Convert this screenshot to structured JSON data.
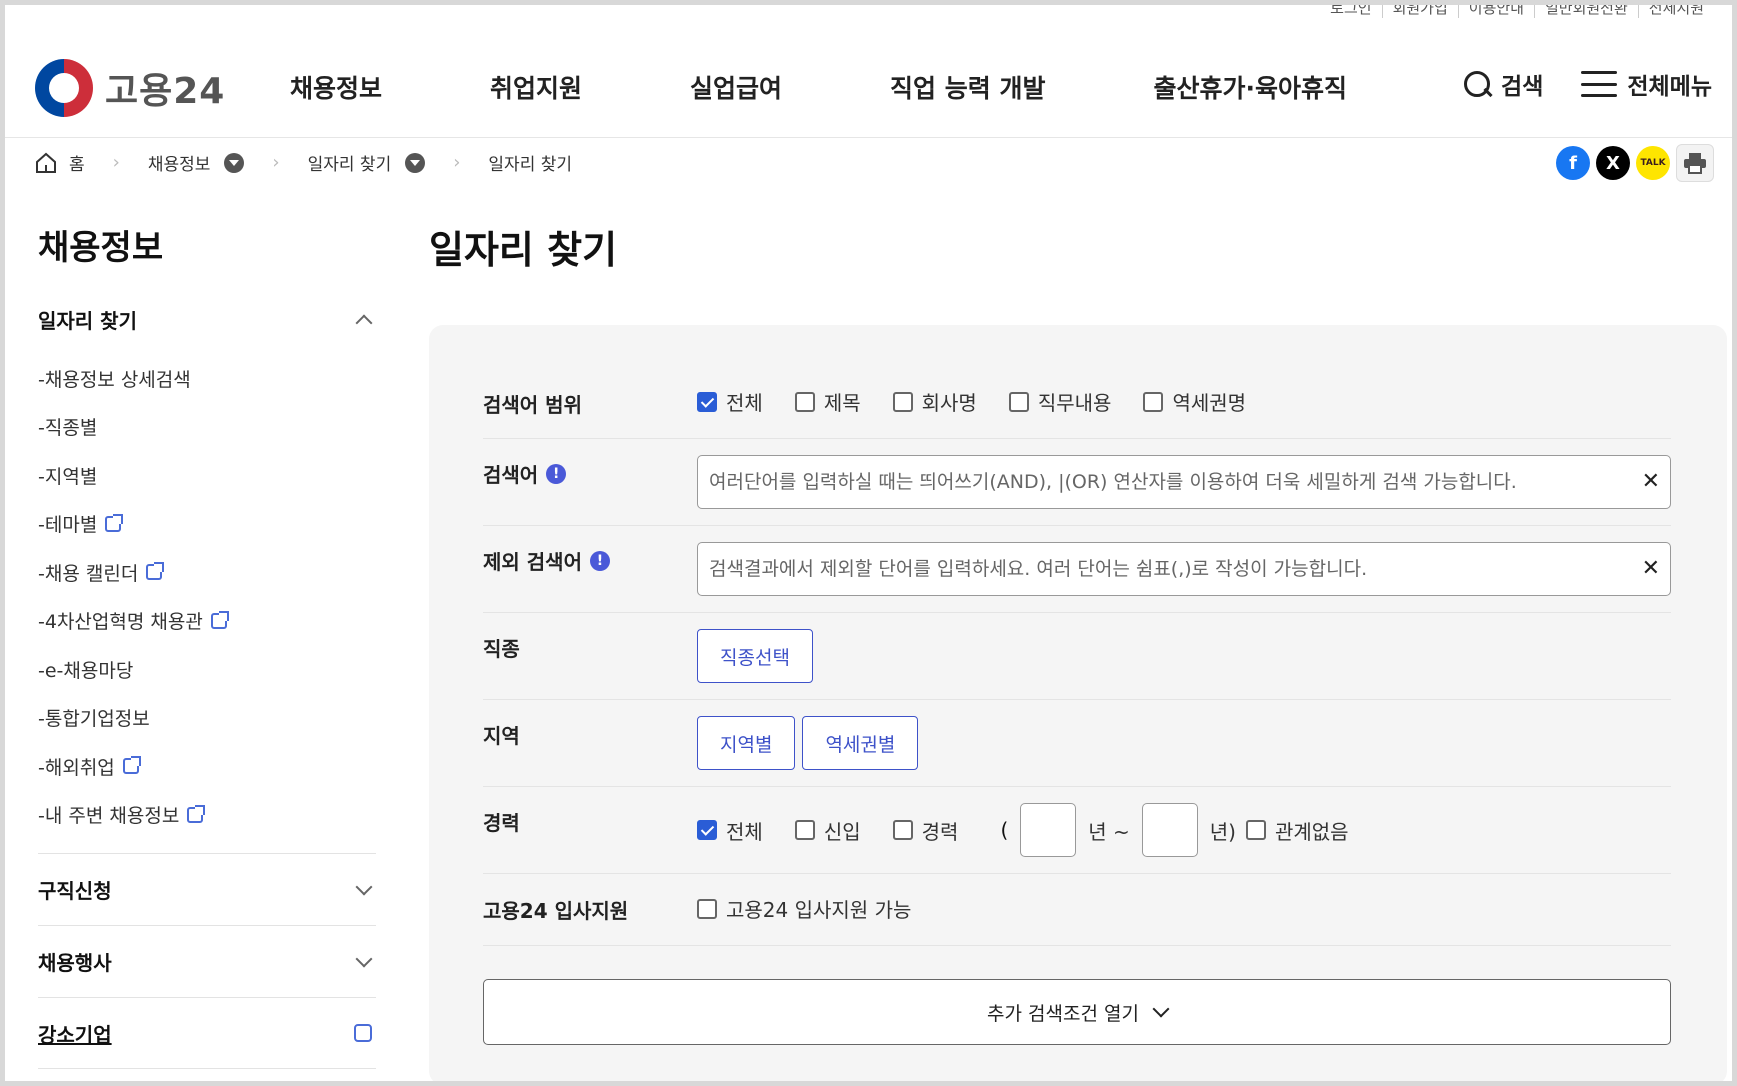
{
  "util_links": [
    "로그인",
    "회원가입",
    "이용안내",
    "일반회원전환",
    "전체지원"
  ],
  "header": {
    "logo_text": "고용24",
    "nav": [
      "채용정보",
      "취업지원",
      "실업급여",
      "직업 능력 개발",
      "출산휴가·육아휴직"
    ],
    "search_label": "검색",
    "menu_label": "전체메뉴"
  },
  "breadcrumb": [
    "홈",
    "채용정보",
    "일자리 찾기",
    "일자리 찾기"
  ],
  "share": {
    "kakao": "TALK"
  },
  "sidebar": {
    "title": "채용정보",
    "section": "일자리 찾기",
    "items": [
      {
        "label": "-채용정보 상세검색",
        "external": false
      },
      {
        "label": "-직종별",
        "external": false
      },
      {
        "label": "-지역별",
        "external": false
      },
      {
        "label": "-테마별",
        "external": true
      },
      {
        "label": "-채용 캘린더",
        "external": true
      },
      {
        "label": "-4차산업혁명 채용관",
        "external": true
      },
      {
        "label": "-e-채용마당",
        "external": false
      },
      {
        "label": "-통합기업정보",
        "external": false
      },
      {
        "label": "-해외취업",
        "external": true
      },
      {
        "label": "-내 주변 채용정보",
        "external": true
      }
    ],
    "groups": [
      "구직신청",
      "채용행사",
      "강소기업"
    ]
  },
  "main": {
    "title": "일자리 찾기",
    "scope": {
      "label": "검색어 범위",
      "options": [
        {
          "label": "전체",
          "checked": true
        },
        {
          "label": "제목",
          "checked": false
        },
        {
          "label": "회사명",
          "checked": false
        },
        {
          "label": "직무내용",
          "checked": false
        },
        {
          "label": "역세권명",
          "checked": false
        }
      ]
    },
    "keyword": {
      "label": "검색어",
      "placeholder": "여러단어를 입력하실 때는 띄어쓰기(AND), |(OR) 연산자를 이용하여 더욱 세밀하게 검색 가능합니다."
    },
    "exclude": {
      "label": "제외 검색어",
      "placeholder": "검색결과에서 제외할 단어를 입력하세요. 여러 단어는 쉼표(,)로 작성이 가능합니다."
    },
    "job": {
      "label": "직종",
      "button": "직종선택"
    },
    "region": {
      "label": "지역",
      "buttons": [
        "지역별",
        "역세권별"
      ]
    },
    "career": {
      "label": "경력",
      "options": [
        {
          "label": "전체",
          "checked": true
        },
        {
          "label": "신입",
          "checked": false
        },
        {
          "label": "경력",
          "checked": false
        }
      ],
      "open_paren": "(",
      "year_from_suffix": "년 ~",
      "year_to_suffix": "년)",
      "none_label": "관계없음",
      "none_checked": false
    },
    "apply": {
      "label": "고용24 입사지원",
      "option": "고용24 입사지원 가능",
      "checked": false
    },
    "more_button": "추가 검색조건 열기"
  }
}
